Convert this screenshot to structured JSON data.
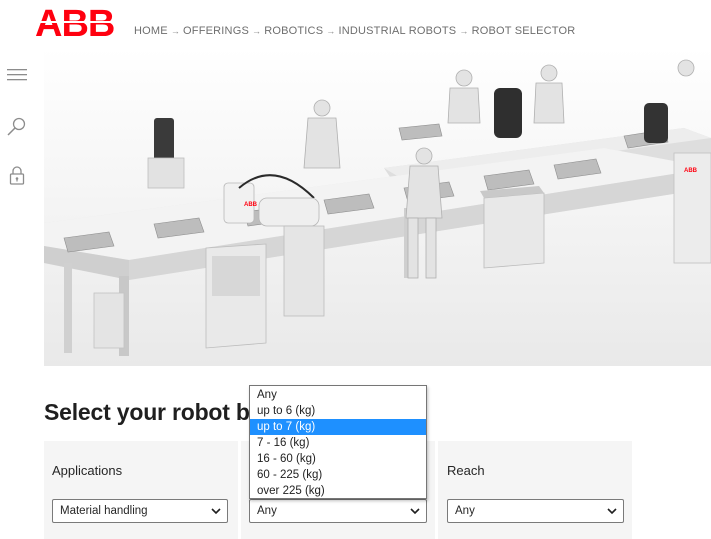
{
  "brand": {
    "logo_text": "ABB",
    "color": "#ff000f"
  },
  "breadcrumb": [
    "HOME",
    "OFFERINGS",
    "ROBOTICS",
    "INDUSTRIAL ROBOTS",
    "ROBOT SELECTOR"
  ],
  "sidebar": {
    "icons": [
      "menu-icon",
      "search-icon",
      "lock-icon"
    ]
  },
  "hero": {
    "alt": "Illustration of workers and ABB robots on a factory assembly line"
  },
  "page": {
    "title": "Select your robot b"
  },
  "filters": {
    "applications": {
      "label": "Applications",
      "value": "Material handling"
    },
    "payload": {
      "value": "Any"
    },
    "reach": {
      "label": "Reach",
      "value": "Any"
    }
  },
  "payload_dropdown": {
    "options": [
      "Any",
      "up to 6 (kg)",
      "up to 7 (kg)",
      "7 - 16 (kg)",
      "16 - 60 (kg)",
      "60 - 225 (kg)",
      "over 225 (kg)"
    ],
    "highlighted_index": 2
  }
}
